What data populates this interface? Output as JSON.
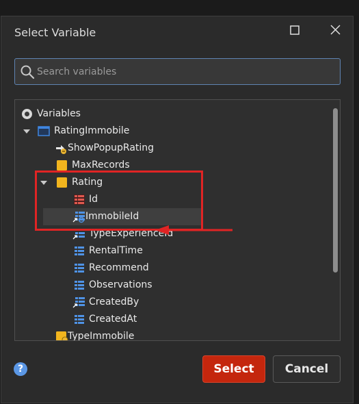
{
  "dialog": {
    "title": "Select Variable"
  },
  "search": {
    "placeholder": "Search variables",
    "value": ""
  },
  "tree": {
    "items": [
      {
        "label": "Variables",
        "icon": "radio-icon"
      },
      {
        "label": "RatingImmobile",
        "icon": "window-icon",
        "expanded": true
      },
      {
        "label": "ShowPopupRating",
        "icon": "action-icon"
      },
      {
        "label": "MaxRecords",
        "icon": "folder-yellow-icon"
      },
      {
        "label": "Rating",
        "icon": "folder-yellow-icon",
        "expanded": true
      },
      {
        "label": "Id",
        "icon": "attribute-id-icon"
      },
      {
        "label": "ImmobileId",
        "icon": "attribute-reference-icon",
        "selected": true
      },
      {
        "label": "TypeExperienceId",
        "icon": "attribute-reference-icon"
      },
      {
        "label": "RentalTime",
        "icon": "attribute-icon"
      },
      {
        "label": "Recommend",
        "icon": "attribute-icon"
      },
      {
        "label": "Observations",
        "icon": "attribute-icon"
      },
      {
        "label": "CreatedBy",
        "icon": "attribute-reference-icon"
      },
      {
        "label": "CreatedAt",
        "icon": "attribute-icon"
      },
      {
        "label": "TypeImmobile",
        "icon": "folder-yellow-icon"
      }
    ]
  },
  "footer": {
    "help_label": "?",
    "select_label": "Select",
    "cancel_label": "Cancel"
  },
  "colors": {
    "accent_red": "#c4260d",
    "annotation_red": "#e02424",
    "search_border": "#5f84b3"
  }
}
